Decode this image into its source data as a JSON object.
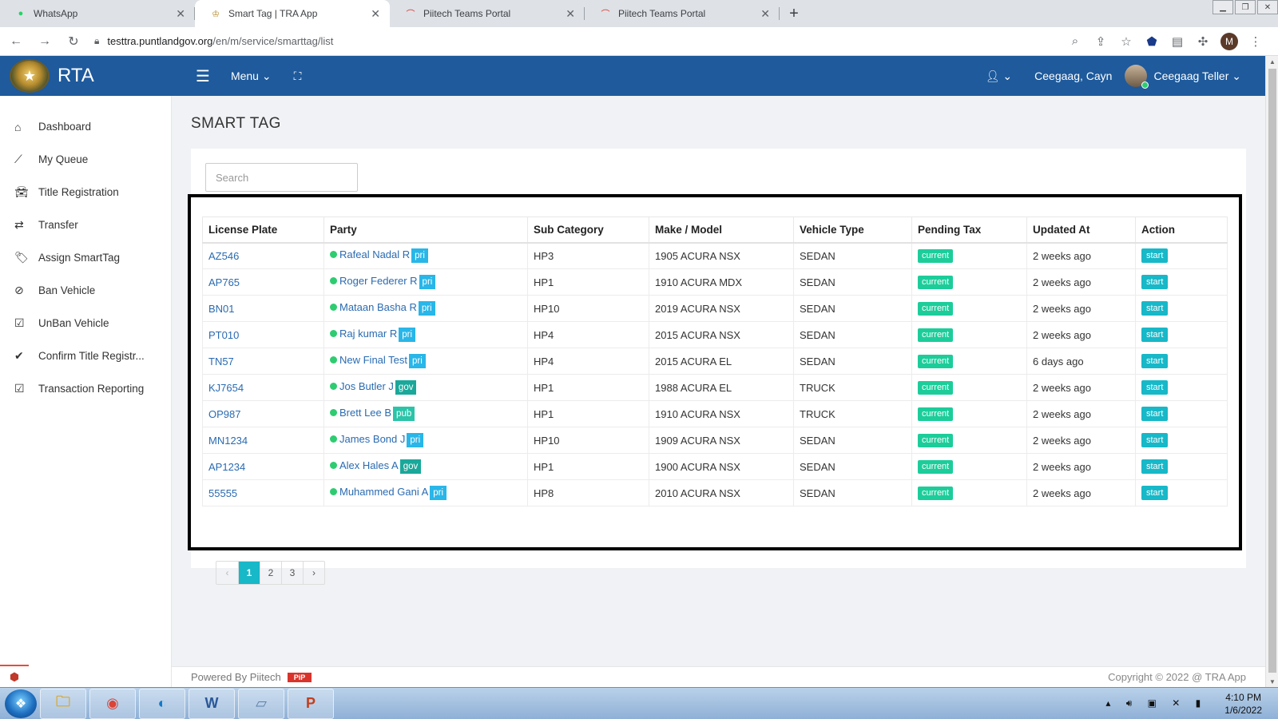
{
  "browser": {
    "tabs": [
      {
        "title": "WhatsApp",
        "icon": "whatsapp-icon"
      },
      {
        "title": "Smart Tag | TRA App",
        "icon": "crest-icon"
      },
      {
        "title": "Piitech Teams Portal",
        "icon": "teams-portal-icon"
      },
      {
        "title": "Piitech Teams Portal",
        "icon": "teams-portal-icon"
      }
    ],
    "active_tab": 1,
    "url_host": "testtra.puntlandgov.org",
    "url_path": "/en/m/service/smarttag/list",
    "profile_initial": "M"
  },
  "header": {
    "brand": "RTA",
    "menu_label": "Menu",
    "user_location": "Ceegaag, Cayn",
    "user_name": "Ceegaag Teller",
    "color": "#1e5a9c"
  },
  "sidebar": {
    "items": [
      {
        "label": "Dashboard",
        "icon": "home-icon"
      },
      {
        "label": "My Queue",
        "icon": "trend-icon"
      },
      {
        "label": "Title Registration",
        "icon": "car-icon"
      },
      {
        "label": "Transfer",
        "icon": "exchange-icon"
      },
      {
        "label": "Assign SmartTag",
        "icon": "tags-icon"
      },
      {
        "label": "Ban Vehicle",
        "icon": "ban-icon"
      },
      {
        "label": "UnBan Vehicle",
        "icon": "check-square-icon"
      },
      {
        "label": "Confirm Title Registr...",
        "icon": "check-icon"
      },
      {
        "label": "Transaction Reporting",
        "icon": "check-square-icon"
      }
    ]
  },
  "page": {
    "title": "SMART TAG",
    "search_placeholder": "Search"
  },
  "table": {
    "columns": [
      "License Plate",
      "Party",
      "Sub Category",
      "Make / Model",
      "Vehicle Type",
      "Pending Tax",
      "Updated At",
      "Action"
    ],
    "rows": [
      {
        "plate": "AZ546",
        "party": "Rafeal Nadal R",
        "party_type": "pri",
        "sub": "HP3",
        "model": "1905 ACURA NSX",
        "vtype": "SEDAN",
        "tax": "current",
        "updated": "2 weeks ago",
        "action": "start"
      },
      {
        "plate": "AP765",
        "party": "Roger Federer R",
        "party_type": "pri",
        "sub": "HP1",
        "model": "1910 ACURA MDX",
        "vtype": "SEDAN",
        "tax": "current",
        "updated": "2 weeks ago",
        "action": "start"
      },
      {
        "plate": "BN01",
        "party": "Mataan Basha R",
        "party_type": "pri",
        "sub": "HP10",
        "model": "2019 ACURA NSX",
        "vtype": "SEDAN",
        "tax": "current",
        "updated": "2 weeks ago",
        "action": "start"
      },
      {
        "plate": "PT010",
        "party": "Raj kumar R",
        "party_type": "pri",
        "sub": "HP4",
        "model": "2015 ACURA NSX",
        "vtype": "SEDAN",
        "tax": "current",
        "updated": "2 weeks ago",
        "action": "start"
      },
      {
        "plate": "TN57",
        "party": "New Final Test",
        "party_type": "pri",
        "sub": "HP4",
        "model": "2015 ACURA EL",
        "vtype": "SEDAN",
        "tax": "current",
        "updated": "6 days ago",
        "action": "start"
      },
      {
        "plate": "KJ7654",
        "party": "Jos Butler J",
        "party_type": "gov",
        "sub": "HP1",
        "model": "1988 ACURA EL",
        "vtype": "TRUCK",
        "tax": "current",
        "updated": "2 weeks ago",
        "action": "start"
      },
      {
        "plate": "OP987",
        "party": "Brett Lee B",
        "party_type": "pub",
        "sub": "HP1",
        "model": "1910 ACURA NSX",
        "vtype": "TRUCK",
        "tax": "current",
        "updated": "2 weeks ago",
        "action": "start"
      },
      {
        "plate": "MN1234",
        "party": "James Bond J",
        "party_type": "pri",
        "sub": "HP10",
        "model": "1909 ACURA NSX",
        "vtype": "SEDAN",
        "tax": "current",
        "updated": "2 weeks ago",
        "action": "start"
      },
      {
        "plate": "AP1234",
        "party": "Alex Hales A",
        "party_type": "gov",
        "sub": "HP1",
        "model": "1900 ACURA NSX",
        "vtype": "SEDAN",
        "tax": "current",
        "updated": "2 weeks ago",
        "action": "start"
      },
      {
        "plate": "55555",
        "party": "Muhammed Gani A",
        "party_type": "pri",
        "sub": "HP8",
        "model": "2010 ACURA NSX",
        "vtype": "SEDAN",
        "tax": "current",
        "updated": "2 weeks ago",
        "action": "start"
      }
    ]
  },
  "pagination": {
    "prev": "‹",
    "pages": [
      "1",
      "2",
      "3"
    ],
    "current": "1",
    "next": "›"
  },
  "footer": {
    "powered": "Powered By Piitech",
    "copyright": "Copyright © 2022 @ TRA App"
  },
  "taskbar": {
    "time": "4:10 PM",
    "date": "1/6/2022",
    "apps": [
      "folder-icon",
      "chrome-icon",
      "edge-icon",
      "word-icon",
      "files-icon",
      "powerpoint-icon"
    ]
  }
}
